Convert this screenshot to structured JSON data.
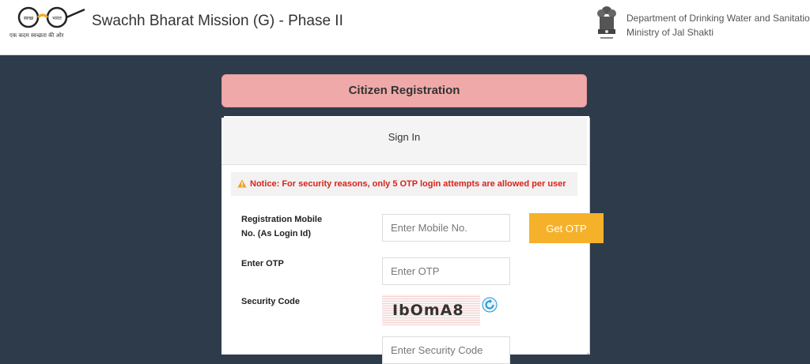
{
  "header": {
    "logo_tagline": "एक कदम स्वच्छता की ओर",
    "logo_word_left": "स्वच्छ",
    "logo_word_right": "भारत",
    "site_title": "Swachh Bharat Mission (G) - Phase II",
    "department": "Department of Drinking Water and Sanitation",
    "ministry": "Ministry of Jal Shakti"
  },
  "registration": {
    "title": "Citizen Registration"
  },
  "signin": {
    "heading": "Sign In",
    "notice": "Notice: For security reasons, only 5 OTP login attempts are allowed per user",
    "mobile_label": "Registration Mobile No. (As Login Id)",
    "mobile_placeholder": "Enter Mobile No.",
    "get_otp_label": "Get OTP",
    "otp_label": "Enter OTP",
    "otp_placeholder": "Enter OTP",
    "security_label": "Security Code",
    "captcha_text": "IbOmA8",
    "security_placeholder": "Enter Security Code"
  },
  "icons": {
    "notice": "warning-icon",
    "refresh": "refresh-icon",
    "logo": "gandhi-spectacles-logo",
    "emblem": "national-emblem"
  },
  "colors": {
    "background": "#2e3b4b",
    "banner": "#f0a9a9",
    "button": "#f5b12a",
    "notice_text": "#d9221b",
    "refresh": "#2196d3"
  }
}
